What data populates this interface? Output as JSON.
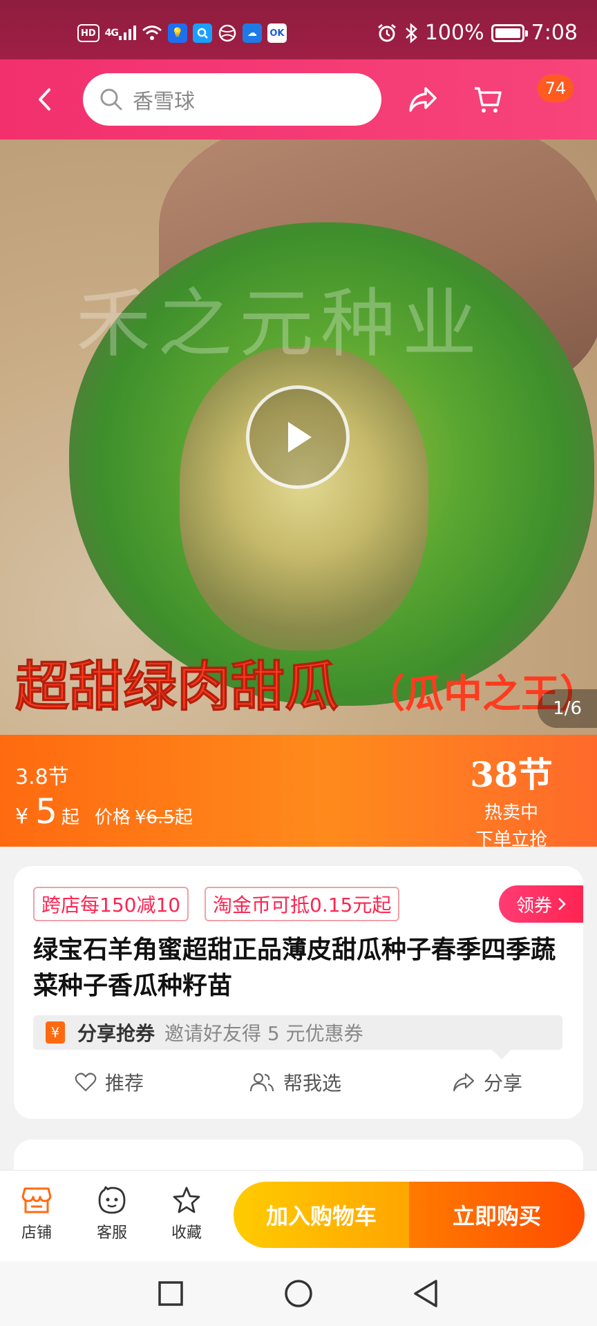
{
  "status_bar": {
    "hd": "HD",
    "network": "4G",
    "battery_text": "100%",
    "battery_level": 1.0,
    "time": "7:08",
    "app_icons": [
      "bulb-icon",
      "search-app-icon",
      "ball-icon",
      "cloud-icon",
      "ok-app-icon"
    ]
  },
  "nav": {
    "search_placeholder": "香雪球",
    "cart_badge": "74"
  },
  "hero": {
    "watermark": "禾之元种业",
    "caption": "超甜绿肉甜瓜",
    "caption_sub": "（瓜中之王）",
    "page_indicator": "1/6"
  },
  "price_banner": {
    "promo_small": "3.8节",
    "currency": "¥",
    "price": "5",
    "price_suffix": "起",
    "orig_label": "价格",
    "orig_currency": "¥",
    "orig_price": "6.5",
    "orig_suffix": "起",
    "promo_big": "38节",
    "promo_hot": "热卖中",
    "promo_order": "下单立抢"
  },
  "info_card": {
    "tags": [
      "跨店每150减10",
      "淘金币可抵0.15元起"
    ],
    "coupon_button": "领券",
    "title": "绿宝石羊角蜜超甜正品薄皮甜瓜种子春季四季蔬菜种子香瓜种籽苗",
    "share_label": "分享抢券",
    "share_desc": "邀请好友得 5 元优惠券",
    "actions": [
      "推荐",
      "帮我选",
      "分享"
    ]
  },
  "bottom_bar": {
    "items": [
      "店铺",
      "客服",
      "收藏"
    ],
    "add_to_cart": "加入购物车",
    "buy_now": "立即购买"
  },
  "colors": {
    "nav_pink": "#f2306e",
    "price_orange": "#ff7a12",
    "tag_red": "#ff2450",
    "cart_yellow": "#ffb800",
    "buy_orange": "#ff5a00"
  }
}
